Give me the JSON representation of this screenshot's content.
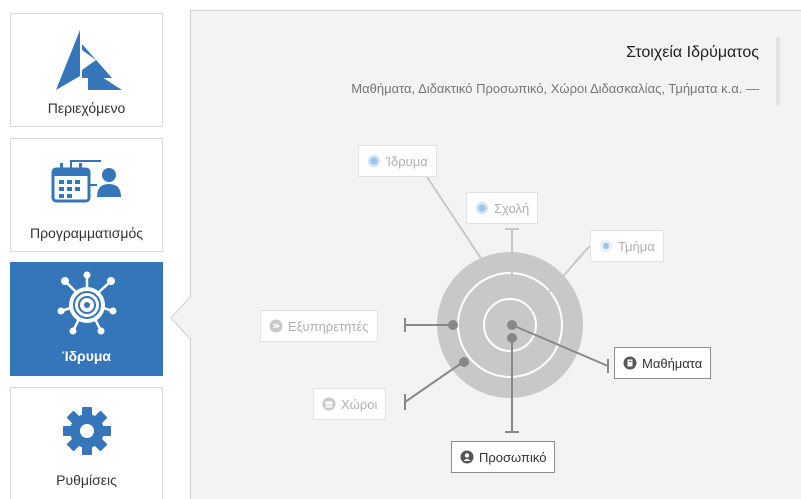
{
  "sidebar": {
    "items": [
      {
        "label": "Περιεχόμενο",
        "icon": "content-logo-icon"
      },
      {
        "label": "Προγραμματισμός",
        "icon": "calendar-user-icon"
      },
      {
        "label": "Ίδρυμα",
        "icon": "institution-target-icon",
        "active": true
      },
      {
        "label": "Ρυθμίσεις",
        "icon": "gear-icon"
      }
    ]
  },
  "panel": {
    "title": "Στοιχεία Ιδρύματος",
    "subtitle": "Μαθήματα, Διδακτικό Προσωπικό, Χώροι Διδασκαλίας, Τμήματα κ.α. —"
  },
  "diagram": {
    "nodes": {
      "institution": {
        "label": "Ίδρυμα",
        "icon": "circle-icon",
        "enabled": false
      },
      "school": {
        "label": "Σχολή",
        "icon": "circle-icon",
        "enabled": false
      },
      "department": {
        "label": "Τμήμα",
        "icon": "circle-icon",
        "enabled": false
      },
      "servers": {
        "label": "Εξυπηρετητές",
        "icon": "server-icon",
        "enabled": false
      },
      "courses": {
        "label": "Μαθήματα",
        "icon": "course-icon",
        "enabled": true
      },
      "rooms": {
        "label": "Χώροι",
        "icon": "room-icon",
        "enabled": false
      },
      "staff": {
        "label": "Προσωπικό",
        "icon": "user-icon",
        "enabled": true
      }
    }
  },
  "colors": {
    "accent": "#3575b9",
    "panel_bg": "#f3f3f3",
    "ring_outer": "#c8c8c8",
    "node_disabled_text": "#b0b0b0",
    "node_enabled_text": "#333333"
  }
}
